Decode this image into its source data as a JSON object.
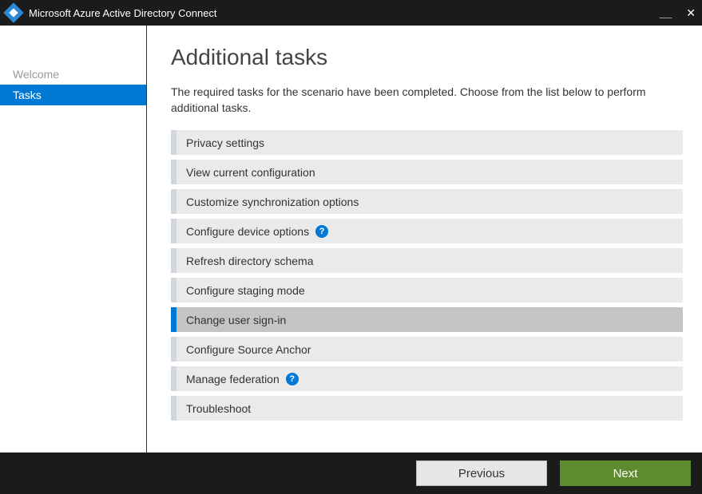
{
  "window": {
    "title": "Microsoft Azure Active Directory Connect"
  },
  "sidebar": {
    "items": [
      {
        "label": "Welcome",
        "active": false
      },
      {
        "label": "Tasks",
        "active": true
      }
    ]
  },
  "main": {
    "title": "Additional tasks",
    "description": "The required tasks for the scenario have been completed. Choose from the list below to perform additional tasks.",
    "tasks": [
      {
        "label": "Privacy settings",
        "selected": false,
        "help": false
      },
      {
        "label": "View current configuration",
        "selected": false,
        "help": false
      },
      {
        "label": "Customize synchronization options",
        "selected": false,
        "help": false
      },
      {
        "label": "Configure device options",
        "selected": false,
        "help": true
      },
      {
        "label": "Refresh directory schema",
        "selected": false,
        "help": false
      },
      {
        "label": "Configure staging mode",
        "selected": false,
        "help": false
      },
      {
        "label": "Change user sign-in",
        "selected": true,
        "help": false
      },
      {
        "label": "Configure Source Anchor",
        "selected": false,
        "help": false
      },
      {
        "label": "Manage federation",
        "selected": false,
        "help": true
      },
      {
        "label": "Troubleshoot",
        "selected": false,
        "help": false
      }
    ]
  },
  "footer": {
    "previous_label": "Previous",
    "next_label": "Next"
  },
  "icons": {
    "help_glyph": "?"
  }
}
